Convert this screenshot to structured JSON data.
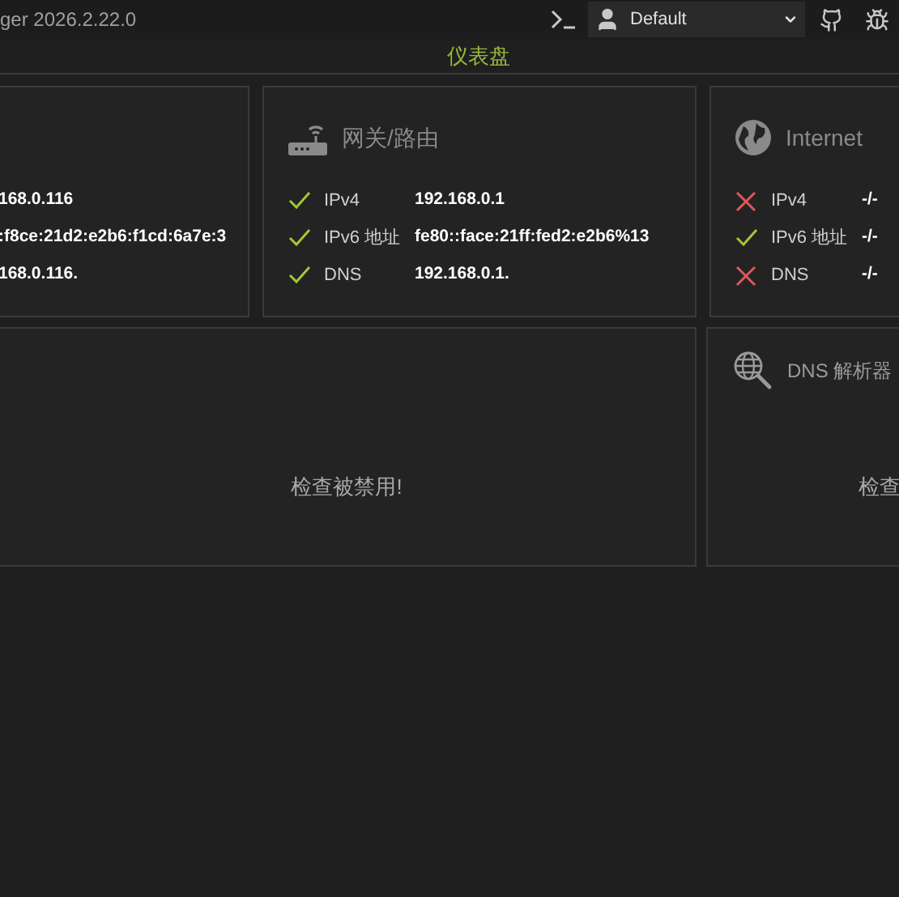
{
  "title_bar": {
    "title": "ger 2026.2.22.0",
    "profile": {
      "value": "Default"
    }
  },
  "page_title": "仪表盘",
  "status_cards": [
    {
      "kind": "local",
      "rows": [
        {
          "value": "168.0.116"
        },
        {
          "value": ":f8ce:21d2:e2b6:f1cd:6a7e:3"
        },
        {
          "value": "168.0.116."
        }
      ]
    },
    {
      "kind": "router",
      "title": "网关/路由",
      "rows": [
        {
          "label": "IPv4",
          "ok": true,
          "value": "192.168.0.1"
        },
        {
          "label": "IPv6 地址",
          "ok": true,
          "value": "fe80::face:21ff:fed2:e2b6%13"
        },
        {
          "label": "DNS",
          "ok": true,
          "value": "192.168.0.1."
        }
      ]
    },
    {
      "kind": "internet",
      "title": "Internet",
      "rows": [
        {
          "label": "IPv4",
          "ok": false,
          "value": "-/-"
        },
        {
          "label": "IPv6 地址",
          "ok": true,
          "value": "-/-"
        },
        {
          "label": "DNS",
          "ok": false,
          "value": "-/-"
        }
      ]
    }
  ],
  "check_cards": [
    {
      "kind": "plain",
      "message": "检查被禁用!"
    },
    {
      "kind": "dns",
      "title": "DNS 解析器",
      "message": "检查"
    }
  ]
}
